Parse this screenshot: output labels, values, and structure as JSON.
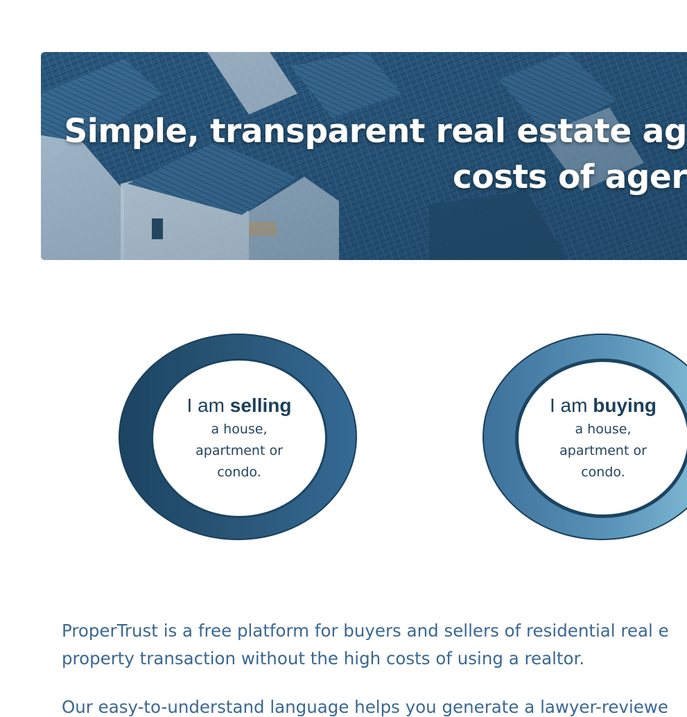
{
  "hero": {
    "title_line1": "Simple, transparent real estate ag",
    "title_line2": "costs of ager"
  },
  "choices": [
    {
      "prefix": "I am ",
      "keyword": "selling",
      "description": "a house, apartment or condo."
    },
    {
      "prefix": "I am ",
      "keyword": "buying",
      "description": "a house, apartment or condo."
    }
  ],
  "intro": {
    "paragraph1_line1": "ProperTrust is a free platform for buyers and sellers of residential real e",
    "paragraph1_line2": "property transaction without the high costs of using a realtor.",
    "paragraph2_line1": "Our easy-to-understand language helps you generate a lawyer-reviewe"
  },
  "colors": {
    "primary_dark": "#1b4462",
    "primary_light": "#86c2da",
    "text_blue": "#3a6894"
  }
}
